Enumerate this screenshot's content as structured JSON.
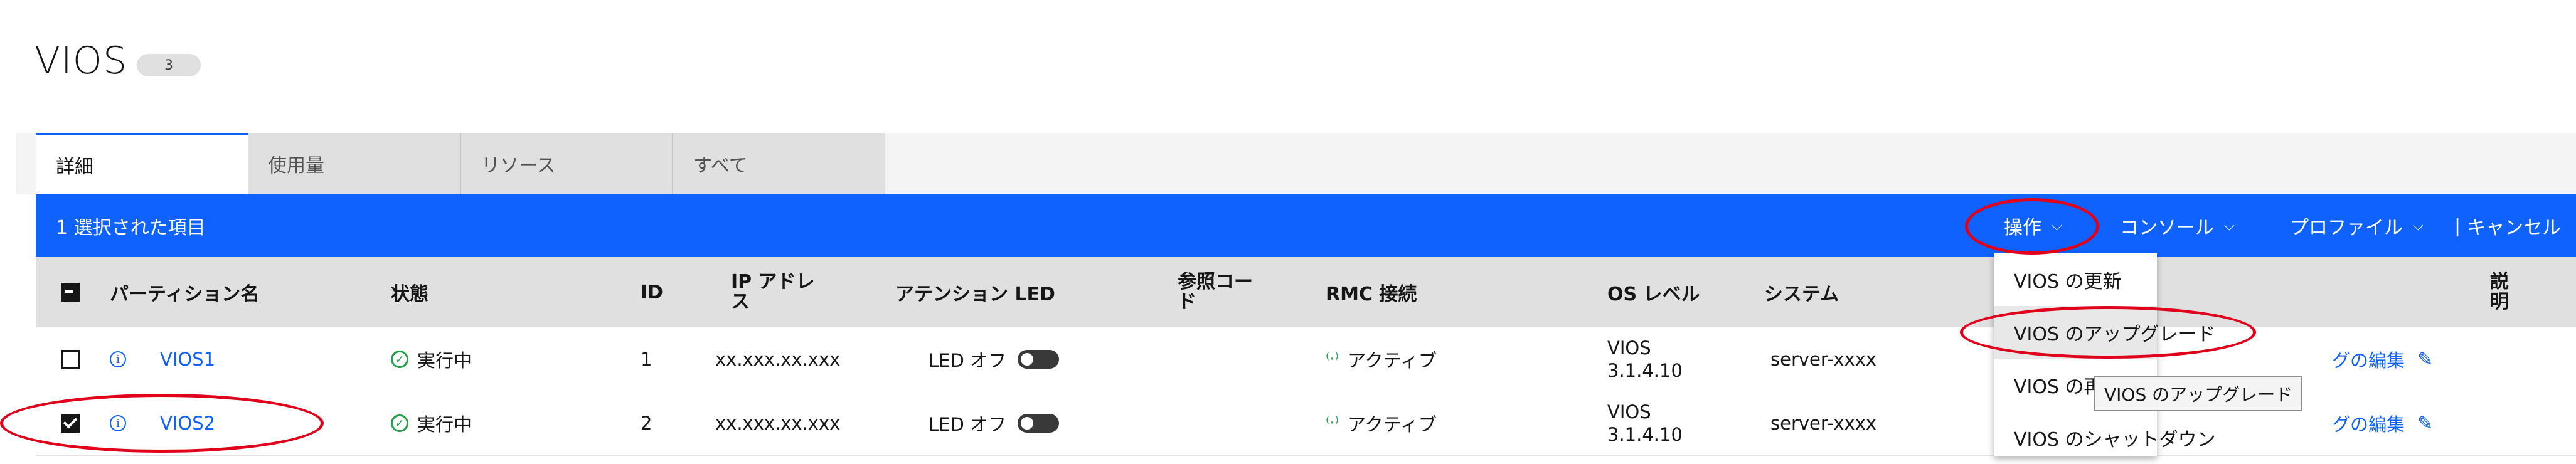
{
  "page": {
    "title": "VIOS",
    "count": "3"
  },
  "tabs": [
    {
      "label": "詳細",
      "active": true
    },
    {
      "label": "使用量",
      "active": false
    },
    {
      "label": "リソース",
      "active": false
    },
    {
      "label": "すべて",
      "active": false
    }
  ],
  "batch_bar": {
    "selected_text": "1 選択された項目",
    "actions_label": "操作",
    "console_label": "コンソール",
    "profile_label": "プロファイル",
    "cancel_label": "キャンセル"
  },
  "table": {
    "headers": {
      "name": "パーティション名",
      "state": "状態",
      "id": "ID",
      "ip": "IP アドレス",
      "led": "アテンション LED",
      "ref_code": "参照コード",
      "rmc": "RMC 接続",
      "os_level": "OS レベル",
      "system": "システム",
      "description": "説明"
    },
    "rows": [
      {
        "name": "VIOS1",
        "state": "実行中",
        "id": "1",
        "ip": "xx.xxx.xx.xxx",
        "led": "LED オフ",
        "rmc": "アクティブ",
        "os_level_1": "VIOS",
        "os_level_2": "3.1.4.10",
        "system": "server-xxxx",
        "edit_tag": "グの編集",
        "checked": false
      },
      {
        "name": "VIOS2",
        "state": "実行中",
        "id": "2",
        "ip": "xx.xxx.xx.xxx",
        "led": "LED オフ",
        "rmc": "アクティブ",
        "os_level_1": "VIOS",
        "os_level_2": "3.1.4.10",
        "system": "server-xxxx",
        "edit_tag": "グの編集",
        "checked": true
      }
    ]
  },
  "actions_menu": {
    "items": [
      "VIOS の更新",
      "VIOS のアップグレード",
      "VIOS の再",
      "VIOS のシャットダウン"
    ],
    "tooltip": "VIOS のアップグレード"
  },
  "colors": {
    "primary": "#0f62fe",
    "annotation": "#e0001a",
    "success": "#24a148"
  }
}
